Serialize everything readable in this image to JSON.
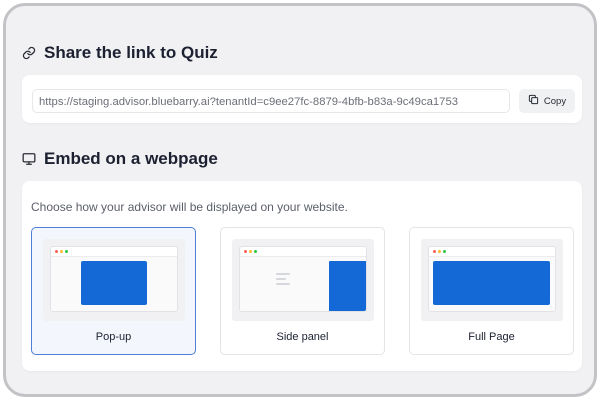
{
  "share": {
    "title": "Share the link to Quiz",
    "icon": "link-icon",
    "link_value": "https://staging.advisor.bluebarry.ai?tenantId=c9ee27fc-8879-4bfb-b83a-9c49ca1753",
    "copy_label": "Copy",
    "copy_icon": "copy-icon"
  },
  "embed": {
    "title": "Embed on a webpage",
    "icon": "monitor-icon",
    "description": "Choose how your advisor will be displayed on your website.",
    "options": [
      {
        "label": "Pop-up",
        "selected": true
      },
      {
        "label": "Side panel",
        "selected": false
      },
      {
        "label": "Full Page",
        "selected": false
      }
    ]
  },
  "colors": {
    "accent_blue": "#1569d6",
    "selected_border": "#4d7fd9",
    "dot_red": "#ff5f57",
    "dot_yellow": "#febc2e",
    "dot_green": "#28c840"
  }
}
